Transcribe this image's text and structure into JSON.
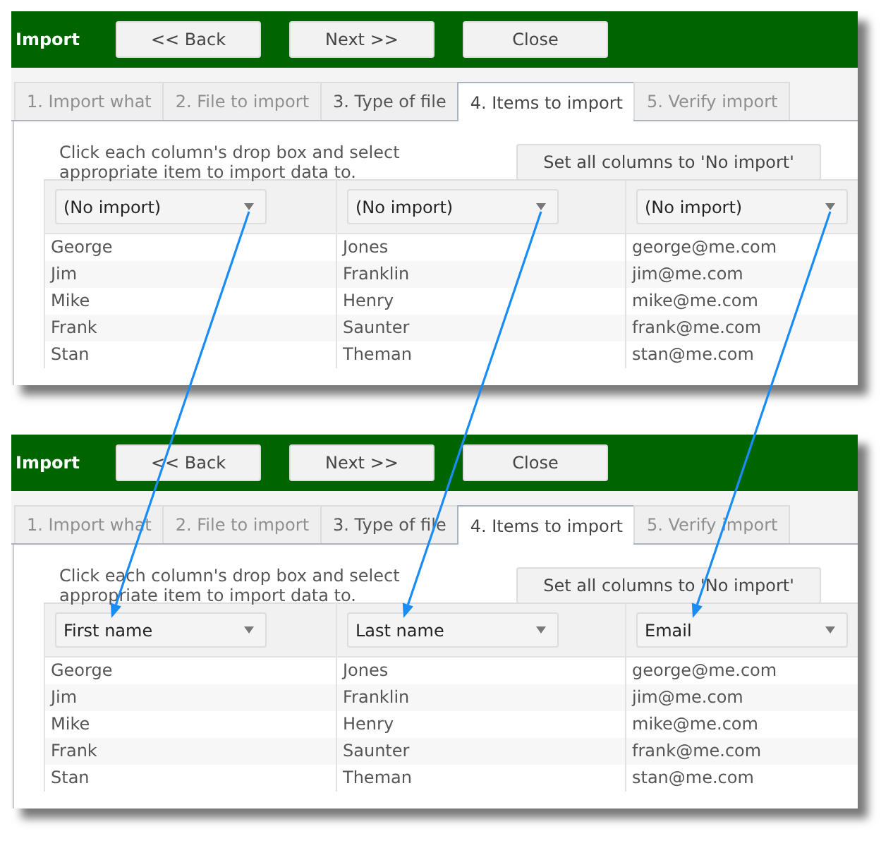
{
  "panels": [
    {
      "title": "Import",
      "buttons": [
        "<< Back",
        "Next >>",
        "Close"
      ],
      "tabs": [
        {
          "label": "1. Import what",
          "selected": false,
          "disabled": true
        },
        {
          "label": "2. File to import",
          "selected": false,
          "disabled": true
        },
        {
          "label": "3. Type of file",
          "selected": false,
          "disabled": false
        },
        {
          "label": "4. Items to import",
          "selected": true,
          "disabled": false
        },
        {
          "label": "5. Verify import",
          "selected": false,
          "disabled": true
        }
      ],
      "instruction": "Click each column's drop box and select appropriate item to import data to.",
      "reset_button": "Set all columns to 'No import'",
      "columns": [
        {
          "value": "(No import)"
        },
        {
          "value": "(No import)"
        },
        {
          "value": "(No import)"
        }
      ],
      "rows": [
        [
          "George",
          "Jones",
          "george@me.com"
        ],
        [
          "Jim",
          "Franklin",
          "jim@me.com"
        ],
        [
          "Mike",
          "Henry",
          "mike@me.com"
        ],
        [
          "Frank",
          "Saunter",
          "frank@me.com"
        ],
        [
          "Stan",
          "Theman",
          "stan@me.com"
        ]
      ]
    },
    {
      "title": "Import",
      "buttons": [
        "<< Back",
        "Next >>",
        "Close"
      ],
      "tabs": [
        {
          "label": "1. Import what",
          "selected": false,
          "disabled": true
        },
        {
          "label": "2. File to import",
          "selected": false,
          "disabled": true
        },
        {
          "label": "3. Type of file",
          "selected": false,
          "disabled": false
        },
        {
          "label": "4. Items to import",
          "selected": true,
          "disabled": false
        },
        {
          "label": "5. Verify import",
          "selected": false,
          "disabled": true
        }
      ],
      "instruction": "Click each column's drop box and select appropriate item to import data to.",
      "reset_button": "Set all columns to 'No import'",
      "columns": [
        {
          "value": "First name"
        },
        {
          "value": "Last name"
        },
        {
          "value": "Email"
        }
      ],
      "rows": [
        [
          "George",
          "Jones",
          "george@me.com"
        ],
        [
          "Jim",
          "Franklin",
          "jim@me.com"
        ],
        [
          "Mike",
          "Henry",
          "mike@me.com"
        ],
        [
          "Frank",
          "Saunter",
          "frank@me.com"
        ],
        [
          "Stan",
          "Theman",
          "stan@me.com"
        ]
      ]
    }
  ]
}
